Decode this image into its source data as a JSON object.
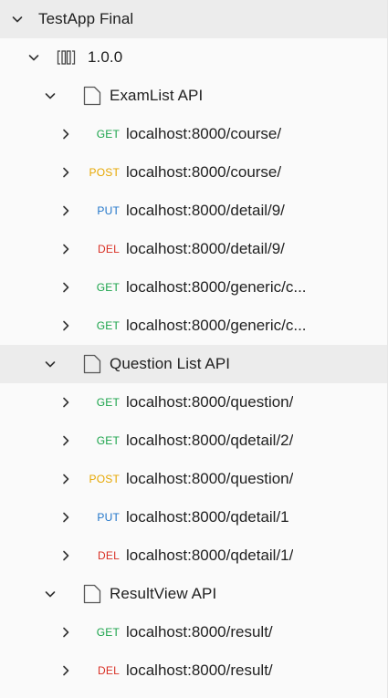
{
  "collection": {
    "name": "TestApp Final",
    "version": {
      "label": "1.0.0",
      "folders": [
        {
          "name": "ExamList API",
          "requests": [
            {
              "method": "GET",
              "url": "localhost:8000/course/"
            },
            {
              "method": "POST",
              "url": "localhost:8000/course/"
            },
            {
              "method": "PUT",
              "url": "localhost:8000/detail/9/"
            },
            {
              "method": "DEL",
              "url": "localhost:8000/detail/9/"
            },
            {
              "method": "GET",
              "url": "localhost:8000/generic/c..."
            },
            {
              "method": "GET",
              "url": "localhost:8000/generic/c..."
            }
          ]
        },
        {
          "name": "Question List API",
          "requests": [
            {
              "method": "GET",
              "url": "localhost:8000/question/"
            },
            {
              "method": "GET",
              "url": "localhost:8000/qdetail/2/"
            },
            {
              "method": "POST",
              "url": "localhost:8000/question/"
            },
            {
              "method": "PUT",
              "url": "localhost:8000/qdetail/1"
            },
            {
              "method": "DEL",
              "url": "localhost:8000/qdetail/1/"
            }
          ]
        },
        {
          "name": "ResultView API",
          "requests": [
            {
              "method": "GET",
              "url": "localhost:8000/result/"
            },
            {
              "method": "DEL",
              "url": "localhost:8000/result/"
            }
          ]
        }
      ]
    }
  },
  "method_colors": {
    "GET": "#1aa34a",
    "POST": "#e6a700",
    "PUT": "#1f74c9",
    "DEL": "#d93025"
  },
  "icons": {
    "expand": "chevron-down-icon",
    "collapse": "chevron-right-icon",
    "version": "version-brackets-icon",
    "folder": "folder-page-icon"
  }
}
